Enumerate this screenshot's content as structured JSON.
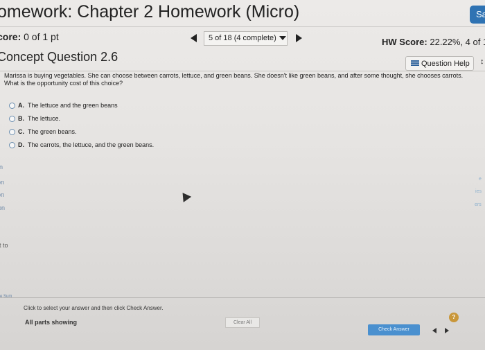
{
  "header": {
    "title": "omework: Chapter 2 Homework (Micro)",
    "save_label": "Sa"
  },
  "scorebar": {
    "score_label": "core:",
    "score_value": "0 of 1 pt",
    "question_nav": "5 of 18 (4 complete)",
    "hw_score_label": "HW Score:",
    "hw_score_value": "22.22%, 4 of 18"
  },
  "concept": {
    "title": "Concept Question 2.6",
    "question_help_label": "Question Help",
    "more_icon": "↕"
  },
  "question": {
    "line1": "Marissa is buying vegetables. She can choose between carrots, lettuce, and green beans. She doesn't like green beans, and after some thought, she chooses carrots.",
    "line2": "What is the opportunity cost of this choice?"
  },
  "options": [
    {
      "letter": "A.",
      "text": "The lettuce and the green beans"
    },
    {
      "letter": "B.",
      "text": "The lettuce."
    },
    {
      "letter": "C.",
      "text": "The green beans."
    },
    {
      "letter": "D.",
      "text": "The carrots, the lettuce, and the green beans."
    }
  ],
  "left_fragments": [
    "n",
    "on",
    "on",
    "on",
    "t to",
    "e Sum"
  ],
  "right_fragments": [
    "e",
    "ies",
    "ers"
  ],
  "footer": {
    "hint": "Click to select your answer and then click Check Answer.",
    "parts_showing": "All parts showing",
    "clear_all": "Clear All",
    "check_answer": "Check Answer",
    "help_badge": "?"
  },
  "colors": {
    "save_button": "#2f73b3",
    "check_button": "#4a90cf",
    "help_badge": "#c9973a"
  }
}
